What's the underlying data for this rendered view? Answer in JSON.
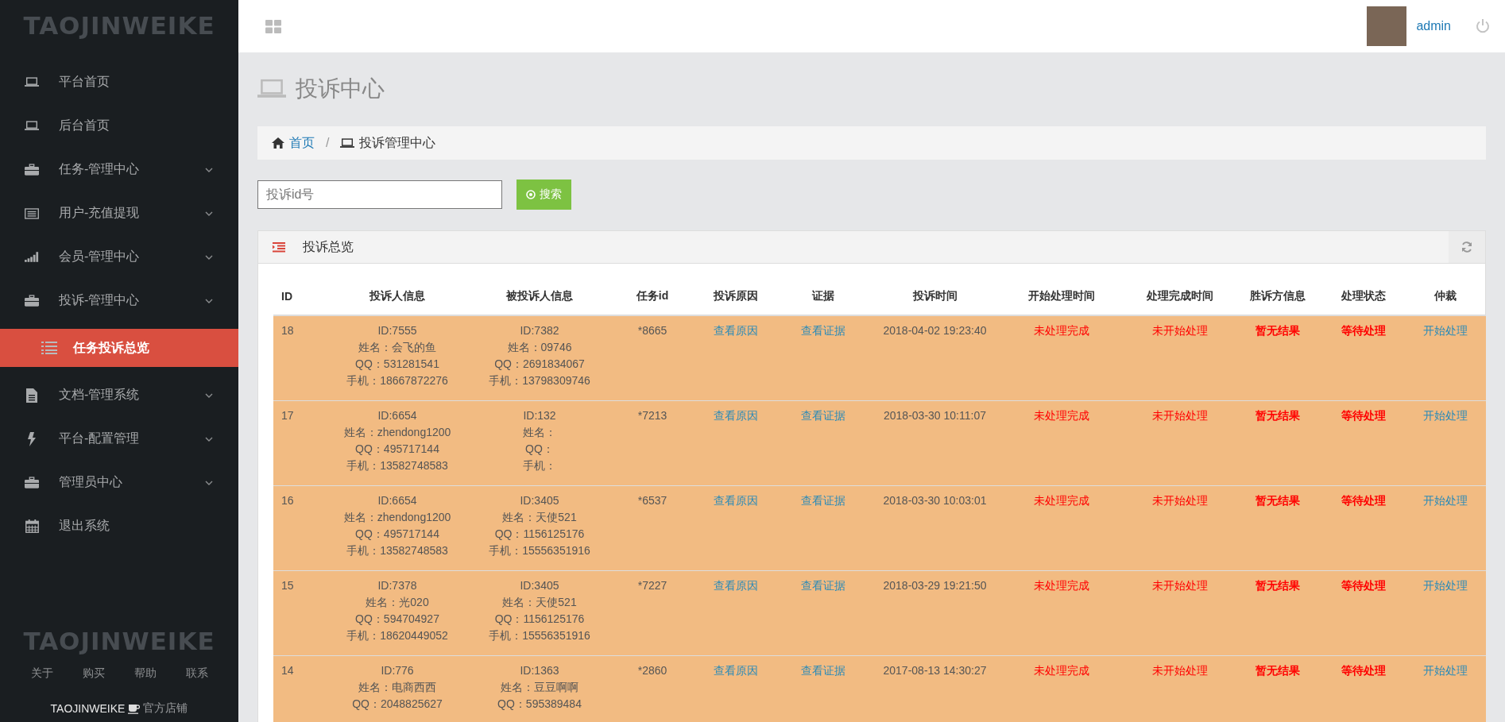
{
  "sidebar": {
    "logo": "TAOJINWEIKE",
    "items": [
      {
        "label": "平台首页",
        "has_submenu": false
      },
      {
        "label": "后台首页",
        "has_submenu": false
      },
      {
        "label": "任务-管理中心",
        "has_submenu": true
      },
      {
        "label": "用户-充值提现",
        "has_submenu": true
      },
      {
        "label": "会员-管理中心",
        "has_submenu": true
      },
      {
        "label": "投诉-管理中心",
        "has_submenu": true,
        "children": [
          {
            "label": "任务投诉总览",
            "selected": true
          }
        ]
      },
      {
        "label": "文档-管理系统",
        "has_submenu": true
      },
      {
        "label": "平台-配置管理",
        "has_submenu": true
      },
      {
        "label": "管理员中心",
        "has_submenu": true
      },
      {
        "label": "退出系统",
        "has_submenu": false
      }
    ],
    "footer_logo": "TAOJINWEIKE",
    "footer_links": [
      "关于",
      "购买",
      "帮助",
      "联系"
    ],
    "brand": "TAOJINWEIKE",
    "shop": "官方店铺"
  },
  "header": {
    "user": "admin"
  },
  "page_title": "投诉中心",
  "breadcrumb": {
    "home": "首页",
    "separator": "/",
    "current": "投诉管理中心"
  },
  "search": {
    "placeholder": "投诉id号",
    "button": "搜索"
  },
  "panel": {
    "title": "投诉总览",
    "table": {
      "columns": [
        {
          "label": "ID",
          "kind": "plain"
        },
        {
          "label": "投诉人信息",
          "kind": "lines"
        },
        {
          "label": "被投诉人信息",
          "kind": "lines"
        },
        {
          "label": "任务id",
          "kind": "plain"
        },
        {
          "label": "投诉原因",
          "kind": "link"
        },
        {
          "label": "证据",
          "kind": "link"
        },
        {
          "label": "投诉时间",
          "kind": "plain"
        },
        {
          "label": "开始处理时间",
          "kind": "alert"
        },
        {
          "label": "处理完成时间",
          "kind": "alert"
        },
        {
          "label": "胜诉方信息",
          "kind": "strong"
        },
        {
          "label": "处理状态",
          "kind": "strong"
        },
        {
          "label": "仲裁",
          "kind": "link"
        }
      ],
      "rows": [
        {
          "highlighted": true,
          "cells": [
            "18",
            [
              "ID:7555",
              "姓名：会飞的鱼",
              "QQ：531281541",
              "手机：18667872276"
            ],
            [
              "ID:7382",
              "姓名：09746",
              "QQ：2691834067",
              "手机：13798309746"
            ],
            "*8665",
            "查看原因",
            "查看证据",
            "2018-04-02 19:23:40",
            "未处理完成",
            "未开始处理",
            "暂无结果",
            "等待处理",
            "开始处理"
          ]
        },
        {
          "highlighted": true,
          "cells": [
            "17",
            [
              "ID:6654",
              "姓名：zhendong1200",
              "QQ：495717144",
              "手机：13582748583"
            ],
            [
              "ID:132",
              "姓名：",
              "QQ：",
              "手机："
            ],
            "*7213",
            "查看原因",
            "查看证据",
            "2018-03-30 10:11:07",
            "未处理完成",
            "未开始处理",
            "暂无结果",
            "等待处理",
            "开始处理"
          ]
        },
        {
          "highlighted": true,
          "cells": [
            "16",
            [
              "ID:6654",
              "姓名：zhendong1200",
              "QQ：495717144",
              "手机：13582748583"
            ],
            [
              "ID:3405",
              "姓名：天使521",
              "QQ：1156125176",
              "手机：15556351916"
            ],
            "*6537",
            "查看原因",
            "查看证据",
            "2018-03-30 10:03:01",
            "未处理完成",
            "未开始处理",
            "暂无结果",
            "等待处理",
            "开始处理"
          ]
        },
        {
          "highlighted": true,
          "cells": [
            "15",
            [
              "ID:7378",
              "姓名：光020",
              "QQ：594704927",
              "手机：18620449052"
            ],
            [
              "ID:3405",
              "姓名：天使521",
              "QQ：1156125176",
              "手机：15556351916"
            ],
            "*7227",
            "查看原因",
            "查看证据",
            "2018-03-29 19:21:50",
            "未处理完成",
            "未开始处理",
            "暂无结果",
            "等待处理",
            "开始处理"
          ]
        },
        {
          "highlighted": true,
          "cells": [
            "14",
            [
              "ID:776",
              "姓名：电商西西",
              "QQ：2048825627"
            ],
            [
              "ID:1363",
              "姓名：豆豆啊啊",
              "QQ：595389484"
            ],
            "*2860",
            "查看原因",
            "查看证据",
            "2017-08-13 14:30:27",
            "未处理完成",
            "未开始处理",
            "暂无结果",
            "等待处理",
            "开始处理"
          ]
        }
      ]
    }
  }
}
